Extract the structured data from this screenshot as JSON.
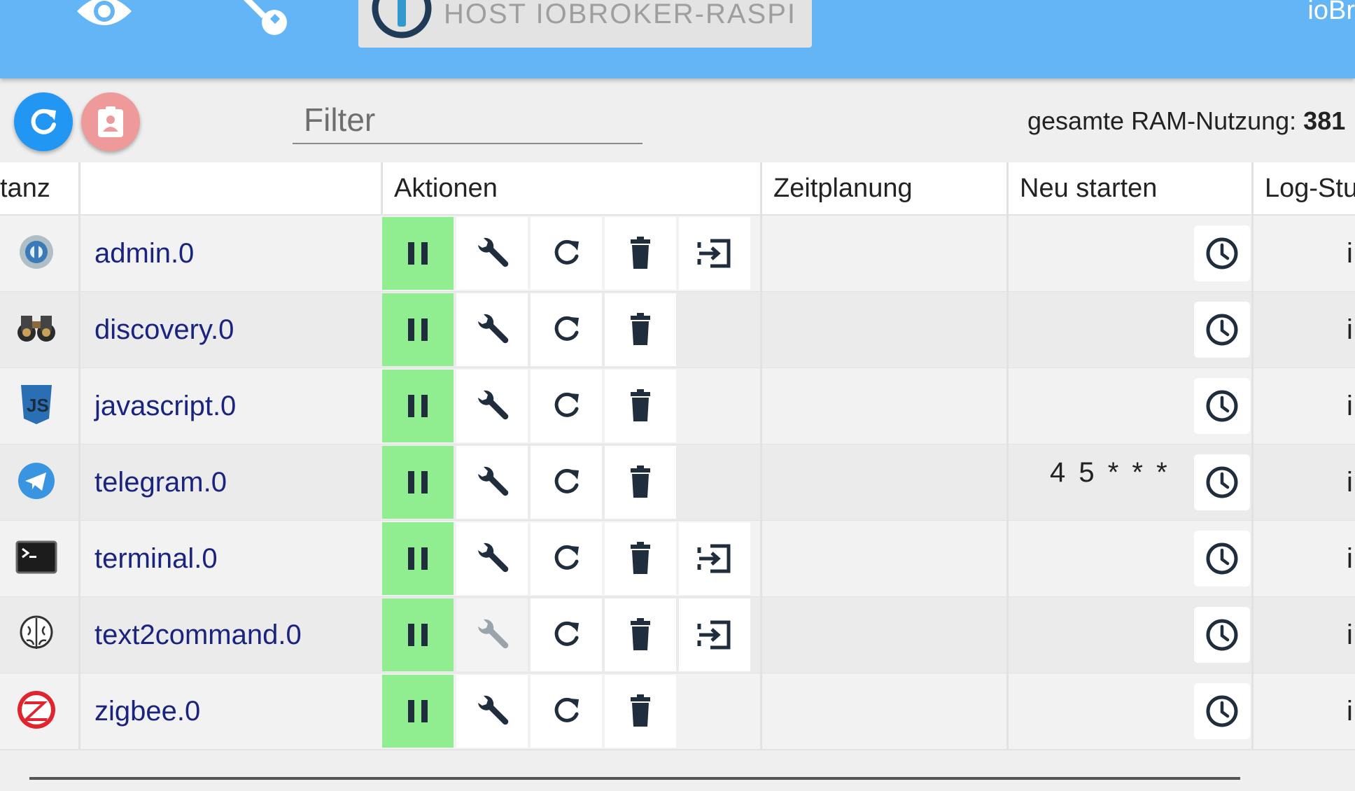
{
  "header": {
    "host_label": "HOST IOBROKER-RASPI",
    "brand": "ioBr",
    "icons": [
      "eye-icon",
      "wrench-icon",
      "iobroker-logo-icon"
    ]
  },
  "toolbar": {
    "refresh_icon": "refresh-icon",
    "contact_icon": "clipboard-account-icon",
    "filter_placeholder": "Filter",
    "ram_label": "gesamte RAM-Nutzung:",
    "ram_value": "381"
  },
  "table": {
    "columns": [
      "tanz",
      "",
      "Aktionen",
      "Zeitplanung",
      "Neu starten",
      "Log-Stu"
    ],
    "rows": [
      {
        "name": "admin.0",
        "icon": "admin-icon",
        "has_log_button": true,
        "wrench_disabled": false,
        "restart_schedule": "",
        "log_level": "i"
      },
      {
        "name": "discovery.0",
        "icon": "binoculars-icon",
        "has_log_button": false,
        "wrench_disabled": false,
        "restart_schedule": "",
        "log_level": "i"
      },
      {
        "name": "javascript.0",
        "icon": "javascript-icon",
        "has_log_button": false,
        "wrench_disabled": false,
        "restart_schedule": "",
        "log_level": "i"
      },
      {
        "name": "telegram.0",
        "icon": "telegram-icon",
        "has_log_button": false,
        "wrench_disabled": false,
        "restart_schedule": "4 5 * * *",
        "log_level": "i"
      },
      {
        "name": "terminal.0",
        "icon": "terminal-icon",
        "has_log_button": true,
        "wrench_disabled": false,
        "restart_schedule": "",
        "log_level": "i"
      },
      {
        "name": "text2command.0",
        "icon": "brain-icon",
        "has_log_button": true,
        "wrench_disabled": true,
        "restart_schedule": "",
        "log_level": "i"
      },
      {
        "name": "zigbee.0",
        "icon": "zigbee-icon",
        "has_log_button": false,
        "wrench_disabled": false,
        "restart_schedule": "",
        "log_level": "i"
      }
    ]
  },
  "colors": {
    "appbar": "#64b5f6",
    "running": "#90ee90",
    "refresh_fab": "#2196f3",
    "contact_fab": "#ef9a9a",
    "instance_name": "#1a237e",
    "icon_dark": "#1f2d3d"
  }
}
